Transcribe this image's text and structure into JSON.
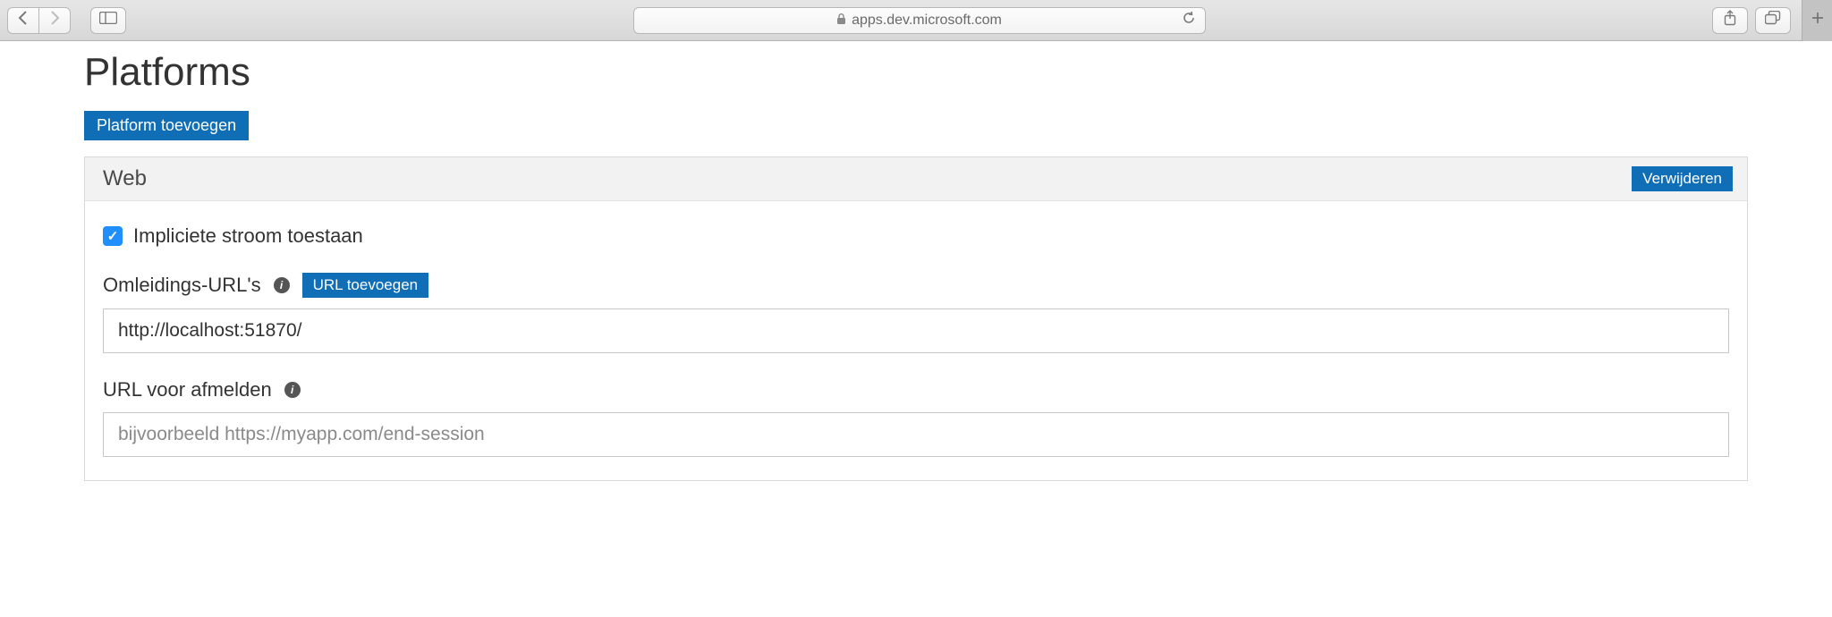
{
  "browser": {
    "url_display": "apps.dev.microsoft.com"
  },
  "page": {
    "title": "Platforms",
    "add_platform_label": "Platform toevoegen"
  },
  "card": {
    "title": "Web",
    "delete_label": "Verwijderen",
    "implicit_flow_label": "Impliciete stroom toestaan",
    "implicit_flow_checked": true,
    "redirect_urls_label": "Omleidings-URL's",
    "add_url_label": "URL toevoegen",
    "redirect_url_value": "http://localhost:51870/",
    "logout_url_label": "URL voor afmelden",
    "logout_url_placeholder": "bijvoorbeeld https://myapp.com/end-session",
    "logout_url_value": ""
  }
}
